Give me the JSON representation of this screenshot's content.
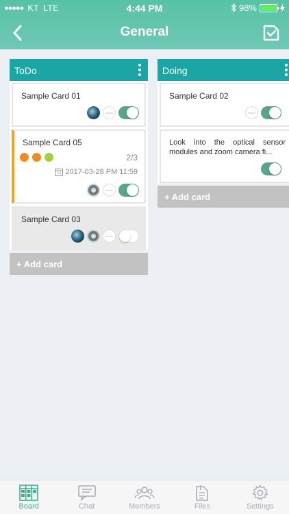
{
  "status": {
    "carrier": "KT",
    "network": "LTE",
    "time": "4:44 PM",
    "battery": "98%",
    "battery_level": 0.98
  },
  "header": {
    "title": "General"
  },
  "columns": [
    {
      "name": "ToDo",
      "add_label": "+ Add card",
      "cards": [
        {
          "title": "Sample Card 01"
        },
        {
          "title": "Sample Card 05",
          "checklist": "2/3",
          "due": "2017-03-28 PM 11:59",
          "label_colors": [
            "#f08a24",
            "#f08a24",
            "#a9cf3a"
          ],
          "accent": "#f3a21c"
        },
        {
          "title": "Sample Card 03"
        }
      ]
    },
    {
      "name": "Doing",
      "add_label": "+ Add card",
      "cards": [
        {
          "title": "Sample Card 02"
        },
        {
          "title": "Look into the optical sensor modules and zoom camera fi..."
        }
      ]
    }
  ],
  "tabs": [
    {
      "label": "Board",
      "active": true
    },
    {
      "label": "Chat"
    },
    {
      "label": "Members"
    },
    {
      "label": "Files"
    },
    {
      "label": "Settings"
    }
  ],
  "colors": {
    "header": "#58c2a6",
    "column_header": "#1ba5a4",
    "toggle_on": "#5aa38d",
    "accent_active": "#3bb08f"
  }
}
